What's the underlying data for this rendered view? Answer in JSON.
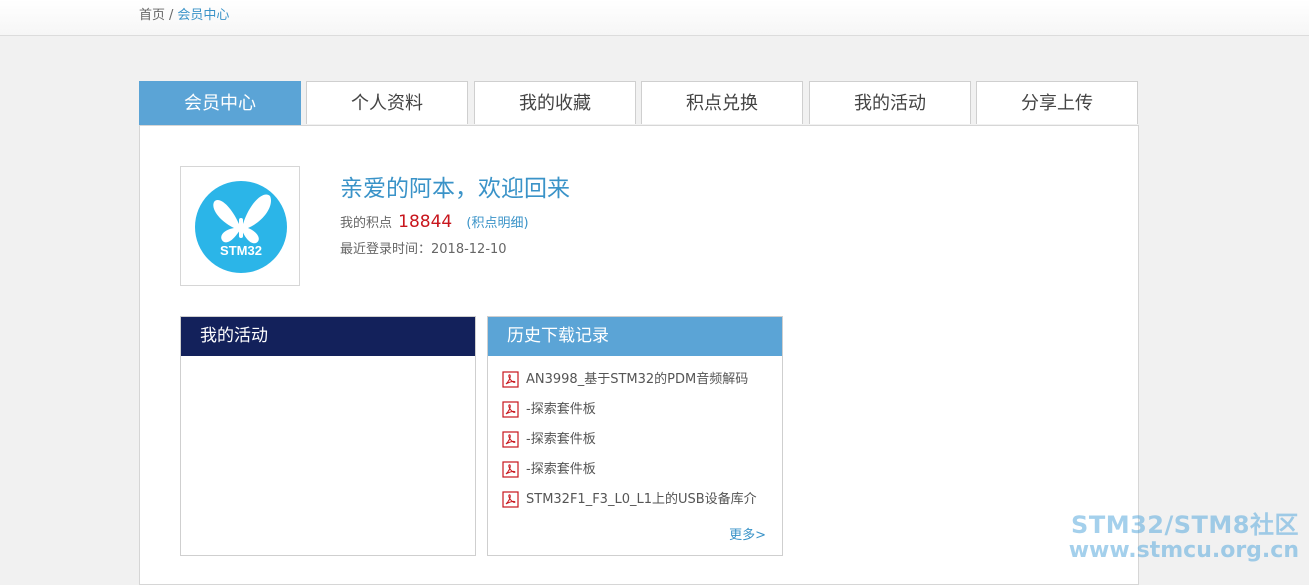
{
  "breadcrumb": {
    "home": "首页",
    "separator": "/",
    "current": "会员中心"
  },
  "tabs": [
    {
      "label": "会员中心",
      "active": true
    },
    {
      "label": "个人资料",
      "active": false
    },
    {
      "label": "我的收藏",
      "active": false
    },
    {
      "label": "积点兑换",
      "active": false
    },
    {
      "label": "我的活动",
      "active": false
    },
    {
      "label": "分享上传",
      "active": false
    }
  ],
  "profile": {
    "avatar_text": "STM32",
    "welcome": "亲爱的阿本，欢迎回来",
    "points_label": "我的积点",
    "points_value": "18844",
    "points_link_open": "(",
    "points_link": "积点明细",
    "points_link_close": ")",
    "last_login_label": "最近登录时间：",
    "last_login_value": "2018-12-10"
  },
  "activity_box": {
    "title": "我的活动"
  },
  "history_box": {
    "title": "历史下载记录",
    "items": [
      "AN3998_基于STM32的PDM音频解码",
      "-探索套件板",
      "-探索套件板",
      "-探索套件板",
      "STM32F1_F3_L0_L1上的USB设备库介"
    ],
    "more": "更多>"
  },
  "watermark": {
    "line1": "STM32/STM8社区",
    "line2": "www.stmcu.org.cn"
  },
  "colors": {
    "accent": "#5ba4d6",
    "navy": "#13215b",
    "link": "#3a93c8",
    "points": "#c8161d",
    "pdf": "#c8161d"
  }
}
